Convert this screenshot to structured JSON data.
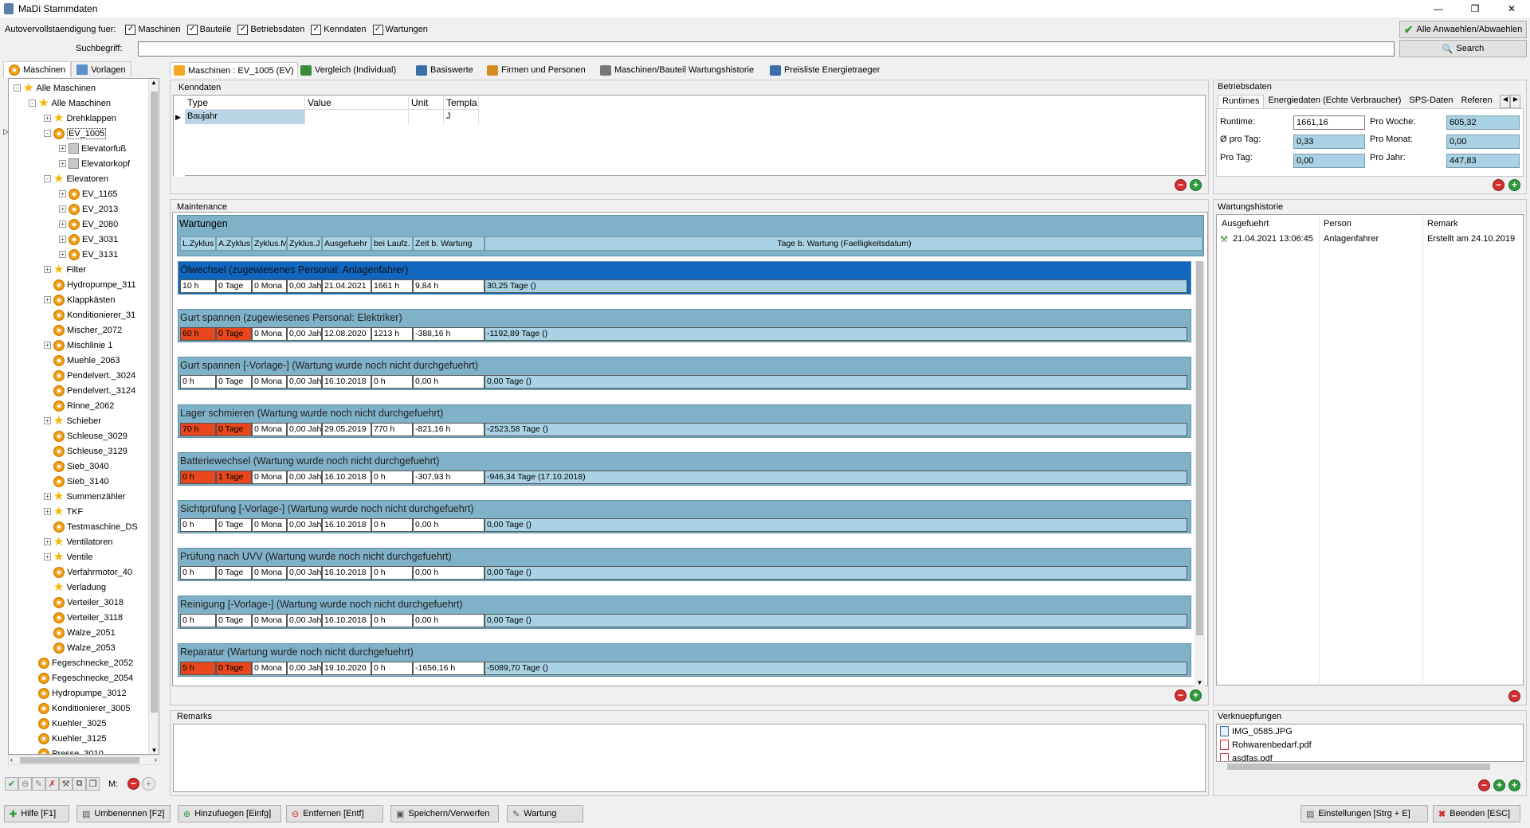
{
  "window": {
    "title": "MaDi Stammdaten",
    "min": "—",
    "max": "❐",
    "close": "✕"
  },
  "autocomplete": {
    "label": "Autovervollstaendigung fuer:",
    "options": [
      {
        "label": "Maschinen",
        "checked": true
      },
      {
        "label": "Bauteile",
        "checked": true
      },
      {
        "label": "Betriebsdaten",
        "checked": true
      },
      {
        "label": "Kenndaten",
        "checked": true
      },
      {
        "label": "Wartungen",
        "checked": true
      }
    ],
    "select_all_label": "Alle Anwaehlen/Abwaehlen"
  },
  "search": {
    "label": "Suchbegriff:",
    "value": "",
    "button": "Search"
  },
  "left_tabs": [
    "Maschinen",
    "Vorlagen"
  ],
  "tree": [
    {
      "label": "Alle Maschinen",
      "level": 0,
      "icon": "star",
      "exp": "-"
    },
    {
      "label": "Alle Maschinen",
      "level": 1,
      "icon": "star",
      "exp": "-"
    },
    {
      "label": "Drehklappen",
      "level": 2,
      "icon": "star",
      "exp": "+"
    },
    {
      "label": "EV_1005",
      "level": 2,
      "icon": "gear",
      "exp": "-",
      "selected": true
    },
    {
      "label": "Elevatorfuß",
      "level": 3,
      "icon": "cube",
      "exp": "+"
    },
    {
      "label": "Elevatorkopf",
      "level": 3,
      "icon": "cube",
      "exp": "+"
    },
    {
      "label": "Elevatoren",
      "level": 2,
      "icon": "star",
      "exp": "-"
    },
    {
      "label": "EV_1165",
      "level": 3,
      "icon": "gear",
      "exp": "+"
    },
    {
      "label": "EV_2013",
      "level": 3,
      "icon": "gear",
      "exp": "+"
    },
    {
      "label": "EV_2080",
      "level": 3,
      "icon": "gear",
      "exp": "+"
    },
    {
      "label": "EV_3031",
      "level": 3,
      "icon": "gear",
      "exp": "+"
    },
    {
      "label": "EV_3131",
      "level": 3,
      "icon": "gear",
      "exp": "+"
    },
    {
      "label": "Filter",
      "level": 2,
      "icon": "star",
      "exp": "+"
    },
    {
      "label": "Hydropumpe_311",
      "level": 2,
      "icon": "gear",
      "exp": ""
    },
    {
      "label": "Klappkästen",
      "level": 2,
      "icon": "gear",
      "exp": "+"
    },
    {
      "label": "Konditionierer_31",
      "level": 2,
      "icon": "gear",
      "exp": ""
    },
    {
      "label": "Mischer_2072",
      "level": 2,
      "icon": "gear",
      "exp": ""
    },
    {
      "label": "Mischlinie 1",
      "level": 2,
      "icon": "gear",
      "exp": "+"
    },
    {
      "label": "Muehle_2063",
      "level": 2,
      "icon": "gear",
      "exp": ""
    },
    {
      "label": "Pendelvert._3024",
      "level": 2,
      "icon": "gear",
      "exp": ""
    },
    {
      "label": "Pendelvert._3124",
      "level": 2,
      "icon": "gear",
      "exp": ""
    },
    {
      "label": "Rinne_2062",
      "level": 2,
      "icon": "gear",
      "exp": ""
    },
    {
      "label": "Schieber",
      "level": 2,
      "icon": "star",
      "exp": "+"
    },
    {
      "label": "Schleuse_3029",
      "level": 2,
      "icon": "gear",
      "exp": ""
    },
    {
      "label": "Schleuse_3129",
      "level": 2,
      "icon": "gear",
      "exp": ""
    },
    {
      "label": "Sieb_3040",
      "level": 2,
      "icon": "gear",
      "exp": ""
    },
    {
      "label": "Sieb_3140",
      "level": 2,
      "icon": "gear",
      "exp": ""
    },
    {
      "label": "Summenzähler",
      "level": 2,
      "icon": "star",
      "exp": "+"
    },
    {
      "label": "TKF",
      "level": 2,
      "icon": "star",
      "exp": "+"
    },
    {
      "label": "Testmaschine_DS",
      "level": 2,
      "icon": "gear",
      "exp": ""
    },
    {
      "label": "Ventilatoren",
      "level": 2,
      "icon": "star",
      "exp": "+"
    },
    {
      "label": "Ventile",
      "level": 2,
      "icon": "star",
      "exp": "+"
    },
    {
      "label": "Verfahrmotor_40",
      "level": 2,
      "icon": "gear",
      "exp": ""
    },
    {
      "label": "Verladung",
      "level": 2,
      "icon": "star",
      "exp": ""
    },
    {
      "label": "Verteiler_3018",
      "level": 2,
      "icon": "gear",
      "exp": ""
    },
    {
      "label": "Verteiler_3118",
      "level": 2,
      "icon": "gear",
      "exp": ""
    },
    {
      "label": "Walze_2051",
      "level": 2,
      "icon": "gear",
      "exp": ""
    },
    {
      "label": "Walze_2053",
      "level": 2,
      "icon": "gear",
      "exp": ""
    },
    {
      "label": "Fegeschnecke_2052",
      "level": 1,
      "icon": "gear",
      "exp": ""
    },
    {
      "label": "Fegeschnecke_2054",
      "level": 1,
      "icon": "gear",
      "exp": ""
    },
    {
      "label": "Hydropumpe_3012",
      "level": 1,
      "icon": "gear",
      "exp": ""
    },
    {
      "label": "Konditionierer_3005",
      "level": 1,
      "icon": "gear",
      "exp": ""
    },
    {
      "label": "Kuehler_3025",
      "level": 1,
      "icon": "gear",
      "exp": ""
    },
    {
      "label": "Kuehler_3125",
      "level": 1,
      "icon": "gear",
      "exp": ""
    },
    {
      "label": "Presse_3010",
      "level": 1,
      "icon": "gear",
      "exp": ""
    }
  ],
  "tree_toolbar_m_label": "M:",
  "main_tabs": [
    "Maschinen : EV_1005 (EV)",
    "Vergleich (Individual)",
    "Basiswerte",
    "Firmen und Personen",
    "Maschinen/Bauteil Wartungshistorie",
    "Preisliste Energietraeger"
  ],
  "kenndaten": {
    "title": "Kenndaten",
    "headers": [
      "Type",
      "Value",
      "Unit",
      "Templa"
    ],
    "rows": [
      [
        "Baujahr",
        "",
        "",
        "J"
      ]
    ]
  },
  "maintenance": {
    "title": "Maintenance",
    "header_title": "Wartungen",
    "columns": [
      "L.Zyklus",
      "A.Zyklus",
      "Zyklus.M",
      "Zyklus.J",
      "Ausgefuehr",
      "bei Laufz.",
      "Zeit b. Wartung",
      "Tage b. Wartung (Faelligkeitsdatum)"
    ],
    "rows": [
      {
        "title": "Ölwechsel (zugewiesenes Personal: Anlagenfahrer)",
        "selected": true,
        "cells": [
          "10 h",
          "0 Tage",
          "0 Mona",
          "0,00 Jah",
          "21.04.2021",
          "1661 h",
          "9,84 h",
          "30,25 Tage ()"
        ],
        "red": [
          false,
          false
        ]
      },
      {
        "title": "Gurt spannen (zugewiesenes Personal: Elektriker)",
        "cells": [
          "60 h",
          "0 Tage",
          "0 Mona",
          "0,00 Jah",
          "12.08.2020",
          "1213 h",
          "-388,16 h",
          "-1192,89 Tage ()"
        ],
        "red": [
          true,
          true
        ]
      },
      {
        "title": "Gurt spannen [-Vorlage-] (Wartung wurde noch nicht durchgefuehrt)",
        "cells": [
          "0 h",
          "0 Tage",
          "0 Mona",
          "0,00 Jah",
          "16.10.2018",
          "0 h",
          "0,00 h",
          "0,00 Tage ()"
        ],
        "red": [
          false,
          false
        ]
      },
      {
        "title": "Lager schmieren (Wartung wurde noch nicht durchgefuehrt)",
        "cells": [
          "70 h",
          "0 Tage",
          "0 Mona",
          "0,00 Jah",
          "29.05.2019",
          "770 h",
          "-821,16 h",
          "-2523,58 Tage ()"
        ],
        "red": [
          true,
          true
        ]
      },
      {
        "title": "Batteriewechsel (Wartung wurde noch nicht durchgefuehrt)",
        "cells": [
          "0 h",
          "1 Tage",
          "0 Mona",
          "0,00 Jah",
          "16.10.2018",
          "0 h",
          "-307,93 h",
          "-946,34 Tage (17.10.2018)"
        ],
        "red": [
          true,
          true
        ]
      },
      {
        "title": "Sichtprüfung [-Vorlage-] (Wartung wurde noch nicht durchgefuehrt)",
        "cells": [
          "0 h",
          "0 Tage",
          "0 Mona",
          "0,00 Jah",
          "16.10.2018",
          "0 h",
          "0,00 h",
          "0,00 Tage ()"
        ],
        "red": [
          false,
          false
        ]
      },
      {
        "title": "Prüfung nach UVV (Wartung wurde noch nicht durchgefuehrt)",
        "cells": [
          "0 h",
          "0 Tage",
          "0 Mona",
          "0,00 Jah",
          "16.10.2018",
          "0 h",
          "0,00 h",
          "0,00 Tage ()"
        ],
        "red": [
          false,
          false
        ]
      },
      {
        "title": "Reinigung [-Vorlage-] (Wartung wurde noch nicht durchgefuehrt)",
        "cells": [
          "0 h",
          "0 Tage",
          "0 Mona",
          "0,00 Jah",
          "16.10.2018",
          "0 h",
          "0,00 h",
          "0,00 Tage ()"
        ],
        "red": [
          false,
          false
        ]
      },
      {
        "title": "Reparatur (Wartung wurde noch nicht durchgefuehrt)",
        "cells": [
          "5 h",
          "0 Tage",
          "0 Mona",
          "0,00 Jah",
          "19.10.2020",
          "0 h",
          "-1656,16 h",
          "-5089,70 Tage ()"
        ],
        "red": [
          true,
          true
        ]
      }
    ]
  },
  "remarks": {
    "title": "Remarks",
    "value": ""
  },
  "betriebsdaten": {
    "title": "Betriebsdaten",
    "tabs": [
      "Runtimes",
      "Energiedaten (Echte Verbraucher)",
      "SPS-Daten",
      "Referen"
    ],
    "fields": {
      "runtime_label": "Runtime:",
      "runtime": "1661,16",
      "pro_woche_label": "Pro Woche:",
      "pro_woche": "605,32",
      "pro_tag_avg_label": "Ø pro Tag:",
      "pro_tag_avg": "0,33",
      "pro_monat_label": "Pro Monat:",
      "pro_monat": "0,00",
      "pro_tag_label": "Pro Tag:",
      "pro_tag": "0,00",
      "pro_jahr_label": "Pro Jahr:",
      "pro_jahr": "447,83"
    }
  },
  "wartungshistorie": {
    "title": "Wartungshistorie",
    "headers": [
      "Ausgefuehrt",
      "Person",
      "Remark"
    ],
    "rows": [
      [
        "21.04.2021 13:06:45",
        "Anlagenfahrer",
        "Erstellt am 24.10.2019"
      ]
    ]
  },
  "verknuepfungen": {
    "title": "Verknuepfungen",
    "files": [
      "IMG_0585.JPG",
      "Rohwarenbedarf.pdf",
      "asdfas.pdf"
    ]
  },
  "bottom_buttons": {
    "help": "Hilfe [F1]",
    "rename": "Umbenennen [F2]",
    "add": "Hinzufuegen [Einfg]",
    "remove": "Entfernen [Entf]",
    "save": "Speichern/Verwerfen",
    "wartung": "Wartung",
    "settings": "Einstellungen [Strg + E]",
    "exit": "Beenden [ESC]"
  }
}
